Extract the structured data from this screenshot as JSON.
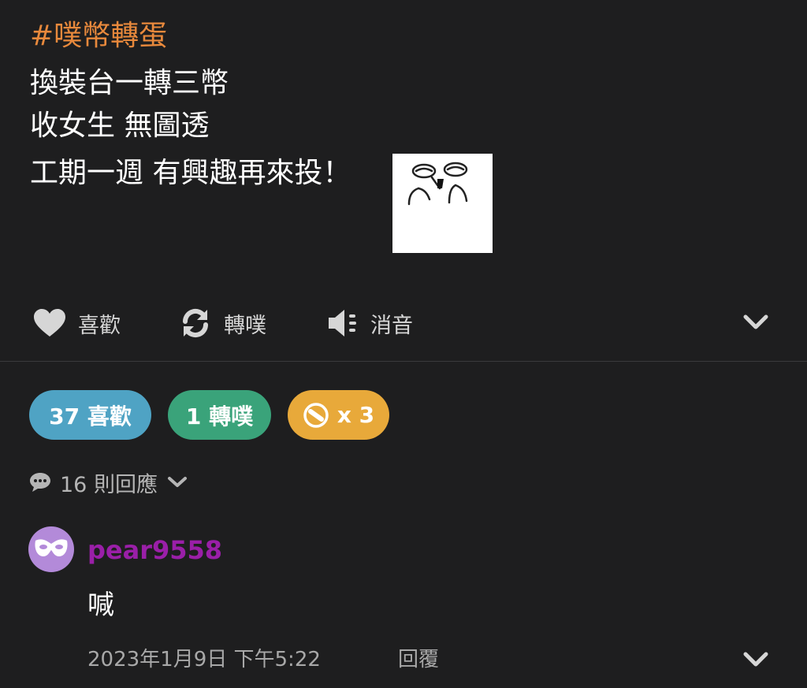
{
  "post": {
    "hashtag": "#噗幣轉蛋",
    "lines": [
      "換裝台一轉三幣",
      "收女生 無圖透",
      "工期一週 有興趣再來投！"
    ],
    "sticker_icon": "laughing-face-sticker"
  },
  "actions": {
    "like_label": "喜歡",
    "replurk_label": "轉噗",
    "mute_label": "消音"
  },
  "stats": {
    "likes_label": "37 喜歡",
    "likes_color": "#4fa3c4",
    "replurks_label": "1 轉噗",
    "replurks_color": "#3aa37a",
    "coins_label": "x 3",
    "coins_color": "#e8a93a"
  },
  "replies": {
    "count_label": "16 則回應"
  },
  "comment": {
    "username": "pear9558",
    "username_color": "#9a1fa8",
    "avatar_color": "#b38ad9",
    "avatar_icon": "mask-icon",
    "text": "喊",
    "timestamp": "2023年1月9日 下午5:22",
    "reply_label": "回覆"
  },
  "colors": {
    "background": "#1e1e1f",
    "hashtag": "#e8893c"
  }
}
